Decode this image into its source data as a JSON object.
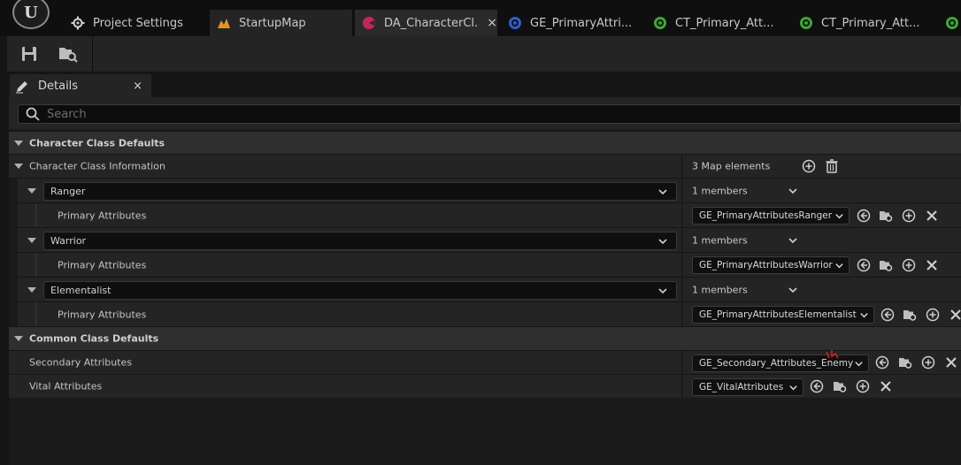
{
  "app": {
    "logo_text": "U",
    "tabs": [
      {
        "label": "Project Settings",
        "icon": "gear-icon"
      },
      {
        "label": "StartupMap",
        "icon": "level-map-icon"
      },
      {
        "label": "DA_CharacterCl...",
        "icon": "data-asset-icon",
        "close": "×"
      },
      {
        "label": "GE_PrimaryAttri...",
        "icon": "blueprint-icon"
      },
      {
        "label": "CT_Primary_Att...",
        "icon": "curve-table-icon"
      },
      {
        "label": "CT_Primary_Att...",
        "icon": "curve-table-icon"
      }
    ]
  },
  "details": {
    "tab_label": "Details",
    "close": "×",
    "search_placeholder": "Search"
  },
  "sections": {
    "character_class_defaults": "Character Class Defaults",
    "character_class_information": "Character Class Information",
    "map_elements": "3 Map elements",
    "common_class_defaults": "Common Class Defaults"
  },
  "entries": [
    {
      "key": "Ranger",
      "members": "1 members",
      "sub_label": "Primary Attributes",
      "value": "GE_PrimaryAttributesRanger"
    },
    {
      "key": "Warrior",
      "members": "1 members",
      "sub_label": "Primary Attributes",
      "value": "GE_PrimaryAttributesWarrior"
    },
    {
      "key": "Elementalist",
      "members": "1 members",
      "sub_label": "Primary Attributes",
      "value": "GE_PrimaryAttributesElementalist"
    }
  ],
  "common": [
    {
      "label": "Secondary Attributes",
      "value": "GE_Secondary_Attributes_Enemy"
    },
    {
      "label": "Vital Attributes",
      "value": "GE_VitalAttributes"
    }
  ],
  "colors": {
    "accent_orange": "#e8912a",
    "data_asset_pink": "#c8245a",
    "blueprint_blue": "#2f5fd0",
    "curve_green": "#3ea82e"
  }
}
